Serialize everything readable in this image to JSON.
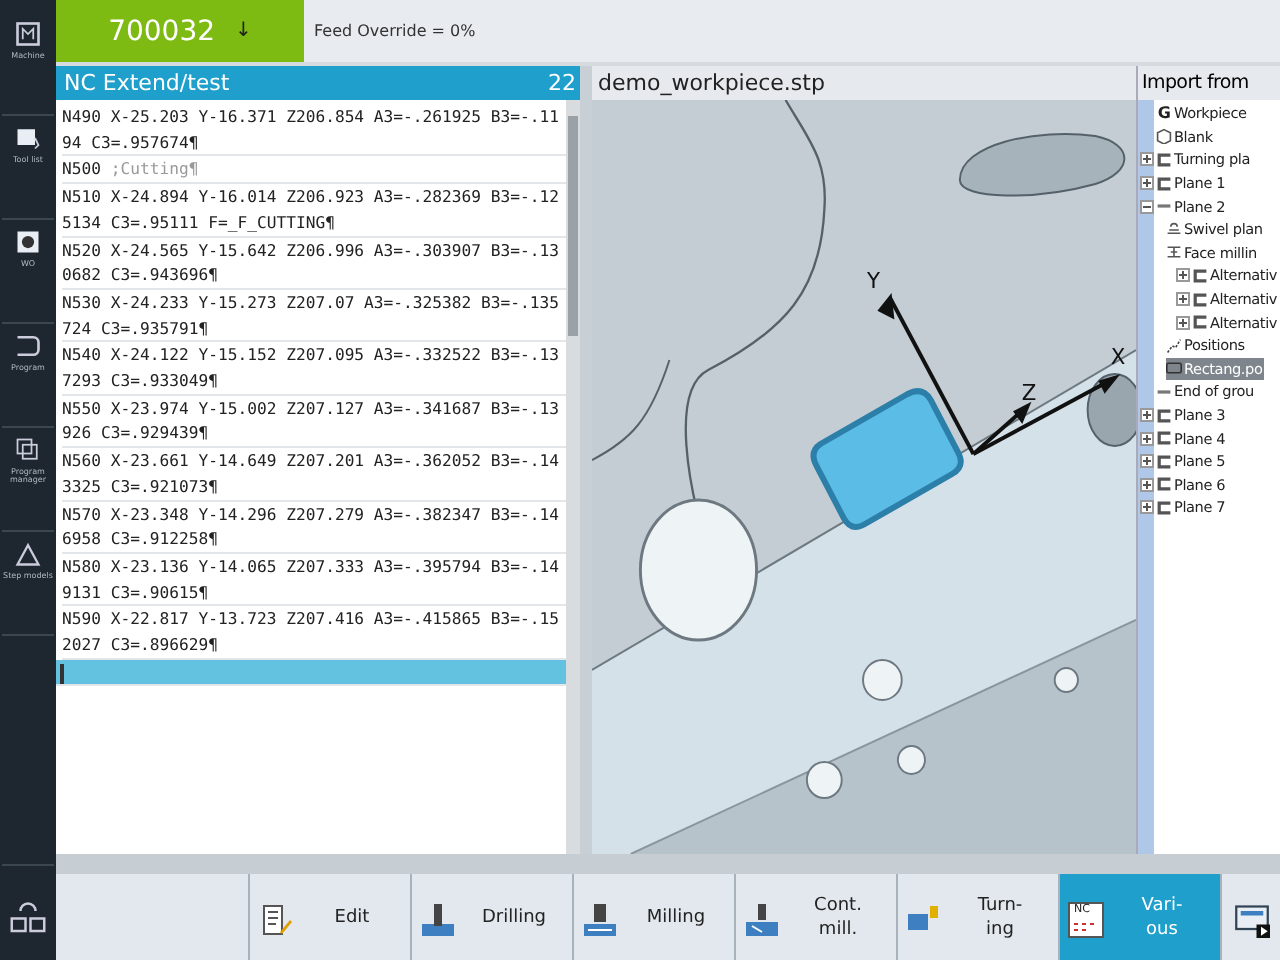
{
  "sidebar": {
    "items": [
      {
        "label": "Machine"
      },
      {
        "label": "Tool list"
      },
      {
        "label": "WO"
      },
      {
        "label": "Program"
      },
      {
        "label": "Program manager"
      },
      {
        "label": "Step models"
      }
    ]
  },
  "top_bar": {
    "program_number": "700032",
    "arrow": "↓",
    "message": "Feed Override = 0%"
  },
  "editor": {
    "title": "NC Extend/test",
    "count": "22",
    "lines": [
      {
        "kind": "code",
        "text": "N490 X-25.203 Y-16.371 Z206.854 A3=-.261925 B3=-.1194 C3=.957674¶",
        "selected": false
      },
      {
        "kind": "comment",
        "text": "N500 ",
        "comment": ";Cutting¶",
        "selected": false
      },
      {
        "kind": "code",
        "text": "N510 X-24.894 Y-16.014 Z206.923 A3=-.282369 B3=-.125134 C3=.95111 F=_F_CUTTING¶",
        "selected": false
      },
      {
        "kind": "code",
        "text": "N520 X-24.565 Y-15.642 Z206.996 A3=-.303907 B3=-.130682 C3=.943696¶",
        "selected": false
      },
      {
        "kind": "code",
        "text": "N530 X-24.233 Y-15.273 Z207.07 A3=-.325382 B3=-.135724 C3=.935791¶",
        "selected": false
      },
      {
        "kind": "code",
        "text": "N540 X-24.122 Y-15.152 Z207.095 A3=-.332522 B3=-.137293 C3=.933049¶",
        "selected": false
      },
      {
        "kind": "code",
        "text": "N550 X-23.974 Y-15.002 Z207.127 A3=-.341687 B3=-.13926 C3=.929439¶",
        "selected": false
      },
      {
        "kind": "code",
        "text": "N560 X-23.661 Y-14.649 Z207.201 A3=-.362052 B3=-.143325 C3=.921073¶",
        "selected": false
      },
      {
        "kind": "code",
        "text": "N570 X-23.348 Y-14.296 Z207.279 A3=-.382347 B3=-.146958 C3=.912258¶",
        "selected": false
      },
      {
        "kind": "code",
        "text": "N580 X-23.136 Y-14.065 Z207.333 A3=-.395794 B3=-.149131 C3=.90615¶",
        "selected": false
      },
      {
        "kind": "code",
        "text": "N590 X-22.817 Y-13.723 Z207.416 A3=-.415865 B3=-.152027 C3=.896629¶",
        "selected": false
      },
      {
        "kind": "cursor",
        "selected": true
      }
    ]
  },
  "viewer": {
    "title": "demo_workpiece.stp",
    "axes": [
      {
        "label": "Y"
      },
      {
        "label": "Z"
      },
      {
        "label": "X"
      }
    ]
  },
  "tree": {
    "title": "Import from",
    "items": [
      {
        "kind": "letter",
        "symbol": "G",
        "label": "Workpiece"
      },
      {
        "kind": "cube",
        "label": "Blank"
      },
      {
        "kind": "plane",
        "label": "Turning pla",
        "expanded": false,
        "selected": false
      },
      {
        "kind": "plane",
        "label": "Plane 1",
        "expanded": false,
        "selected": false
      },
      {
        "kind": "flat",
        "label": "Plane 2",
        "expanded": true,
        "selected": false,
        "children": [
          {
            "kind": "swivel",
            "label": "Swivel plan",
            "selected": false
          },
          {
            "kind": "face",
            "label": "Face millin",
            "selected": false,
            "children": [
              {
                "kind": "plane",
                "label": "Alternativ",
                "expanded": false,
                "selected": false
              },
              {
                "kind": "plane",
                "label": "Alternativ",
                "expanded": false,
                "selected": false
              },
              {
                "kind": "plane",
                "label": "Alternativ",
                "expanded": false,
                "selected": false
              }
            ]
          },
          {
            "kind": "positions",
            "label": "Positions",
            "selected": false
          },
          {
            "kind": "pocket",
            "label": "Rectang.po",
            "selected": true
          }
        ]
      },
      {
        "kind": "flat",
        "label": "End of grou",
        "selected": false
      },
      {
        "kind": "plane",
        "label": "Plane 3",
        "expanded": false,
        "selected": false
      },
      {
        "kind": "plane",
        "label": "Plane 4",
        "expanded": false,
        "selected": false
      },
      {
        "kind": "plane",
        "label": "Plane 5",
        "expanded": false,
        "selected": false
      },
      {
        "kind": "plane",
        "label": "Plane 6",
        "expanded": false,
        "selected": false
      },
      {
        "kind": "plane",
        "label": "Plane 7",
        "expanded": false,
        "selected": false
      }
    ]
  },
  "softkeys": [
    {
      "label": "Edit",
      "selected": false
    },
    {
      "label": "Drilling",
      "selected": false
    },
    {
      "label": "Milling",
      "selected": false
    },
    {
      "label": "Cont.\nmill.",
      "selected": false
    },
    {
      "label": "Turn-\ning",
      "selected": false
    },
    {
      "label": "Vari-\nous",
      "symbol": "NC",
      "selected": true
    }
  ]
}
